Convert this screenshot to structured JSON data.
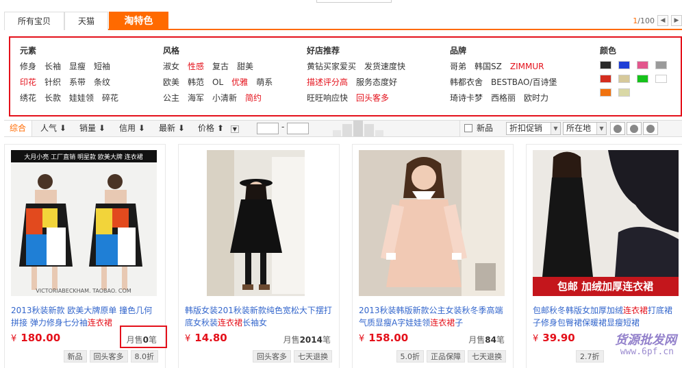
{
  "tabs": [
    {
      "label": "所有宝贝"
    },
    {
      "label": "天猫"
    },
    {
      "label": "淘特色"
    }
  ],
  "pager": {
    "current": "1",
    "total": "/100"
  },
  "filters": {
    "elements": {
      "title": "元素",
      "rows": [
        [
          {
            "label": "修身",
            "hl": false
          },
          {
            "label": "长袖",
            "hl": false
          },
          {
            "label": "显瘦",
            "hl": false
          },
          {
            "label": "短袖",
            "hl": false
          }
        ],
        [
          {
            "label": "印花",
            "hl": true
          },
          {
            "label": "针织",
            "hl": false
          },
          {
            "label": "系带",
            "hl": false
          },
          {
            "label": "条纹",
            "hl": false
          }
        ],
        [
          {
            "label": "绣花",
            "hl": false
          },
          {
            "label": "长款",
            "hl": false
          },
          {
            "label": "娃娃领",
            "hl": false
          },
          {
            "label": "碎花",
            "hl": false
          }
        ]
      ]
    },
    "style": {
      "title": "风格",
      "rows": [
        [
          {
            "label": "淑女",
            "hl": false
          },
          {
            "label": "性感",
            "hl": true
          },
          {
            "label": "复古",
            "hl": false
          },
          {
            "label": "甜美",
            "hl": false
          }
        ],
        [
          {
            "label": "欧美",
            "hl": false
          },
          {
            "label": "韩范",
            "hl": false
          },
          {
            "label": "OL",
            "hl": false
          },
          {
            "label": "优雅",
            "hl": true
          },
          {
            "label": "萌系",
            "hl": false
          }
        ],
        [
          {
            "label": "公主",
            "hl": false
          },
          {
            "label": "海军",
            "hl": false
          },
          {
            "label": "小清新",
            "hl": false
          },
          {
            "label": "简约",
            "hl": true
          }
        ]
      ]
    },
    "shops": {
      "title": "好店推荐",
      "rows": [
        [
          {
            "label": "黄钻买家爱买",
            "hl": false
          },
          {
            "label": "发货速度快",
            "hl": false
          }
        ],
        [
          {
            "label": "描述评分高",
            "hl": true
          },
          {
            "label": "服务态度好",
            "hl": false
          }
        ],
        [
          {
            "label": "旺旺响应快",
            "hl": false
          },
          {
            "label": "回头客多",
            "hl": true
          }
        ]
      ]
    },
    "brands": {
      "title": "品牌",
      "rows": [
        [
          {
            "label": "哥弟",
            "hl": false
          },
          {
            "label": "韩国SZ",
            "hl": false
          },
          {
            "label": "ZIMMUR",
            "hl": true
          }
        ],
        [
          {
            "label": "韩都衣舍",
            "hl": false
          },
          {
            "label": "BESTBAO/百诗堡",
            "hl": false
          }
        ],
        [
          {
            "label": "琦诗卡梦",
            "hl": false
          },
          {
            "label": "西格丽",
            "hl": false
          },
          {
            "label": "欧时力",
            "hl": false
          }
        ]
      ]
    },
    "colors": {
      "title": "颜色",
      "swatches": [
        "#2a2a2a",
        "#1f3fd6",
        "#e2578d",
        "#9a9a9a",
        "#d42d1f",
        "#d6c99b",
        "#16c21b",
        "#ffffff",
        "#f0720f",
        "#d9d8a6"
      ]
    }
  },
  "sortbar": {
    "items": [
      "综合",
      "人气",
      "销量",
      "信用",
      "最新",
      "价格"
    ],
    "price_sep": "-",
    "new_label": "新品",
    "promo_label": "折扣促销",
    "location_label": "所在地"
  },
  "products": [
    {
      "title_a": "2013秋装新款 欧美大牌原单 撞色几何拼接 弹力修身七分袖",
      "title_hl": "连衣裙",
      "title_b": "",
      "price": "180.00",
      "sales_prefix": "月售",
      "sales_num": "0",
      "sales_suffix": "笔",
      "tags": [
        "新品",
        "回头客多",
        "8.0折"
      ],
      "banner": "大月小亮 工厂直销 明星款 欧美大牌 连衣裙",
      "caption": "VICTORIABECKHAM. TAOBAO. COM"
    },
    {
      "title_a": "韩版女装201秋装新款纯色宽松大下摆打底女秋装",
      "title_hl": "连衣裙",
      "title_b": "长袖女",
      "price": "14.80",
      "sales_prefix": "月售",
      "sales_num": "2014",
      "sales_suffix": "笔",
      "tags": [
        "回头客多",
        "七天退换"
      ]
    },
    {
      "title_a": "2013秋装韩版新款公主女装秋冬季高端气质显瘦A字娃娃领",
      "title_hl": "连衣裙",
      "title_b": "子",
      "price": "158.00",
      "sales_prefix": "月售",
      "sales_num": "84",
      "sales_suffix": "笔",
      "tags": [
        "5.0折",
        "正品保障",
        "七天退换"
      ]
    },
    {
      "title_a": "包邮秋冬韩版女加厚加绒",
      "title_hl": "连衣裙",
      "title_b": "打底裙子修身包臀裙保暖裙显瘦短裙",
      "price": "39.90",
      "sales_prefix": "",
      "sales_num": "",
      "sales_suffix": "",
      "tags": [
        "2.7折"
      ],
      "banner": "包邮 加绒加厚连衣裙"
    }
  ],
  "currency": "¥",
  "watermark": {
    "line1": "货源批发网",
    "line2": "www.6pf.cn"
  }
}
